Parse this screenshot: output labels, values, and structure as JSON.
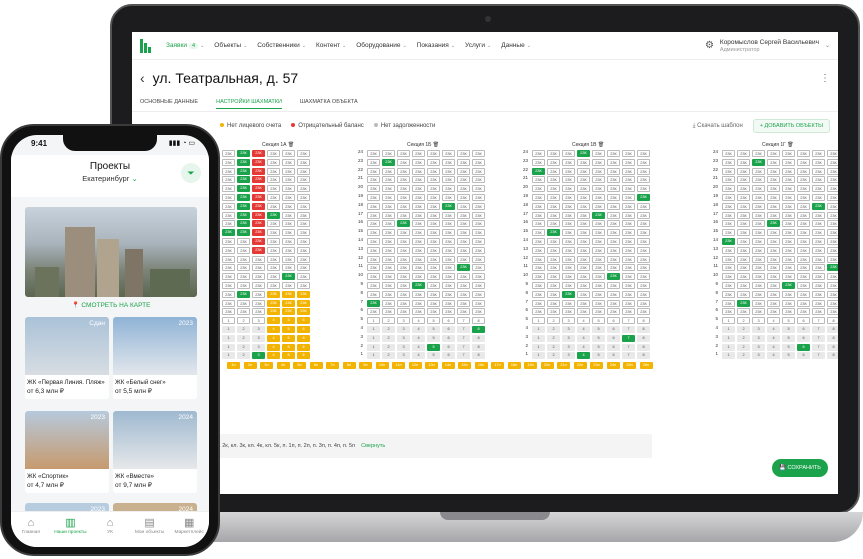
{
  "desktop": {
    "menu": [
      {
        "label": "Заявки",
        "badge": "4",
        "active": true
      },
      {
        "label": "Объекты"
      },
      {
        "label": "Собственники"
      },
      {
        "label": "Контент"
      },
      {
        "label": "Оборудование"
      },
      {
        "label": "Показания"
      },
      {
        "label": "Услуги"
      },
      {
        "label": "Данные"
      }
    ],
    "user_name": "Коромыслов Сергей Васильевич",
    "user_role": "Администратор",
    "page_title": "ул. Театральная, д. 57",
    "tabs": [
      "ОСНОВНЫЕ ДАННЫЕ",
      "НАСТРОЙКИ ШАХМАТКИ",
      "ШАХМАТКА ОБЪЕКТА"
    ],
    "legend": [
      {
        "label": "Нет лицевого счета",
        "color": "#f2b400"
      },
      {
        "label": "Отрицательный баланс",
        "color": "#e53935"
      },
      {
        "label": "Нет задолженности",
        "color": "#bbbbbb"
      }
    ],
    "download_label": "Скачать шаблон",
    "add_label": "+ ДОБАВИТЬ ОБЪЕКТЫ",
    "sections": [
      "Секция 1А",
      "Секция 1Б",
      "Секция 1В",
      "Секция 1Г"
    ],
    "floor_labels": [
      "24",
      "23",
      "22",
      "21",
      "20",
      "19",
      "18",
      "17",
      "16",
      "15",
      "14",
      "13",
      "12",
      "11",
      "10",
      "9",
      "8",
      "7",
      "6",
      "5",
      "4",
      "3",
      "2",
      "1"
    ],
    "cell_label": "23К",
    "selected_text": "ж у объектов: кв. 121, кв. 1к, кл. 2к, кл. 3к, кл. 4к, кл. 5к, п. 1п, п. 2п, п. 3п, п. 4п, п. 5п",
    "collapse_label": "Свернуть",
    "save_label": "СОХРАНИТЬ"
  },
  "phone": {
    "time": "9:41",
    "title": "Проекты",
    "city": "Екатеринбург",
    "map_label": "СМОТРЕТЬ НА КАРТЕ",
    "cards": [
      {
        "name": "ЖК «Первая Линия. Пляж»",
        "price": "от 6,3 млн ₽",
        "tag": "Сдан"
      },
      {
        "name": "ЖК «Белый снег»",
        "price": "от 5,5 млн ₽",
        "tag": "2023"
      },
      {
        "name": "ЖК «Спортик»",
        "price": "от 4,7 млн ₽",
        "tag": "2023"
      },
      {
        "name": "ЖК «Вместе»",
        "price": "от 9,7 млн ₽",
        "tag": "2024"
      }
    ],
    "extra_tags": [
      "2023",
      "2024"
    ],
    "tabbar": [
      {
        "label": "Главная",
        "icon": "home-icon"
      },
      {
        "label": "Наши проекты",
        "icon": "buildings-icon",
        "active": true
      },
      {
        "label": "УК",
        "icon": "house-icon"
      },
      {
        "label": "Мои объекты",
        "icon": "objects-icon"
      },
      {
        "label": "Маркетплейс",
        "icon": "shop-icon"
      }
    ]
  },
  "colors": {
    "accent": "#1aa34a",
    "red": "#e53935",
    "yellow": "#f2b400"
  }
}
